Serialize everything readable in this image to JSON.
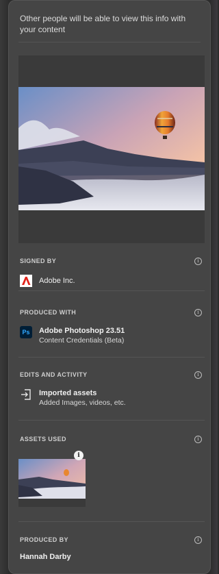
{
  "notice": "Other people will be able to view this info with your content",
  "signed_by": {
    "title": "SIGNED BY",
    "name": "Adobe Inc."
  },
  "produced_with": {
    "title": "PRODUCED WITH",
    "app": "Adobe Photoshop 23.51",
    "detail": "Content Credentials (Beta)",
    "app_icon_text": "Ps"
  },
  "edits": {
    "title": "EDITS AND ACTIVITY",
    "item": "Imported assets",
    "detail": "Added Images, videos, etc."
  },
  "assets": {
    "title": "ASSETS USED"
  },
  "produced_by": {
    "title": "PRODUCED BY",
    "name": "Hannah Darby"
  },
  "icons": {
    "info": "info-circle-icon",
    "adobe": "adobe-logo-icon",
    "photoshop": "photoshop-app-icon",
    "import": "import-icon"
  },
  "colors": {
    "panel": "#454545",
    "adobe_red": "#e2231a",
    "ps_blue": "#001e36",
    "ps_text": "#31a8ff"
  }
}
